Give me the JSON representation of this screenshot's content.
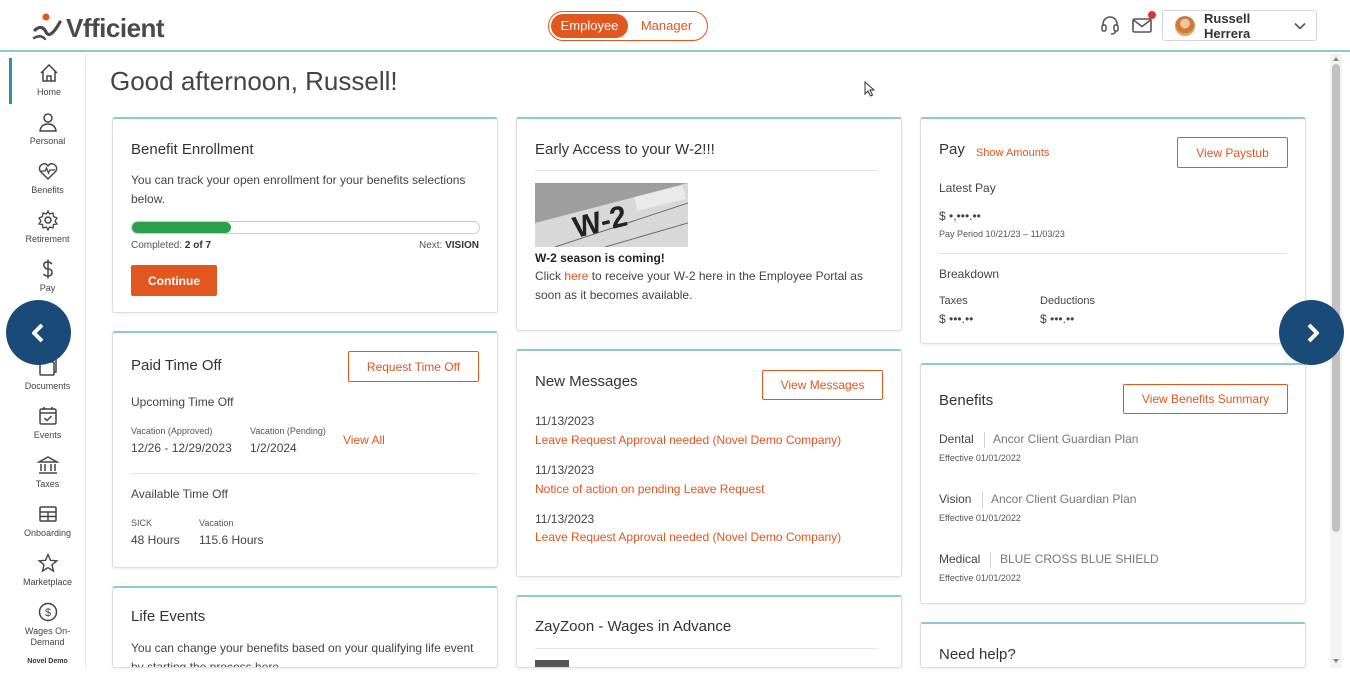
{
  "brand": {
    "name": "Vfficient",
    "accent": "#e2561f",
    "teal": "#2a93a3",
    "navy": "#1a4b78"
  },
  "header": {
    "toggle": [
      "Employee",
      "Manager"
    ],
    "active_view": "Employee",
    "icons": [
      "headset-icon",
      "mail-icon"
    ],
    "user_name": "Russell Herrera"
  },
  "sidebar": {
    "items": [
      {
        "label": "Home",
        "icon": "home-icon"
      },
      {
        "label": "Personal",
        "icon": "person-icon"
      },
      {
        "label": "Benefits",
        "icon": "heartbeat-icon"
      },
      {
        "label": "Retirement",
        "icon": "gear-icon"
      },
      {
        "label": "Pay",
        "icon": "dollar-icon"
      },
      {
        "label": "Documents",
        "icon": "documents-icon"
      },
      {
        "label": "Events",
        "icon": "calendar-icon"
      },
      {
        "label": "Taxes",
        "icon": "bank-icon"
      },
      {
        "label": "Onboarding",
        "icon": "table-icon"
      },
      {
        "label": "Marketplace",
        "icon": "star-icon"
      },
      {
        "label": "Wages On-Demand",
        "icon": "coin-icon"
      }
    ],
    "active": "Home",
    "company": "Novel Demo"
  },
  "greeting": "Good afternoon, Russell!",
  "benefit_enrollment": {
    "title": "Benefit Enrollment",
    "body": "You can track your open enrollment for your benefits selections below.",
    "completed_label": "Completed:",
    "completed_value": "2 of 7",
    "progress": 0.2857,
    "next_label": "Next:",
    "next_value": "VISION",
    "button": "Continue"
  },
  "pto": {
    "title": "Paid Time Off",
    "button": "Request Time Off",
    "upcoming_label": "Upcoming Time Off",
    "approved_label": "Vacation (Approved)",
    "approved_value": "12/26 - 12/29/2023",
    "pending_label": "Vacation (Pending)",
    "pending_value": "1/2/2024",
    "view_all": "View All",
    "available_label": "Available Time Off",
    "sick_label": "SICK",
    "sick_value": "48 Hours",
    "vacation_label": "Vacation",
    "vacation_value": "115.6 Hours"
  },
  "life_events": {
    "title": "Life Events",
    "body": "You can change your benefits based on your qualifying life event by starting the process here."
  },
  "w2": {
    "title": "Early Access to your W-2!!!",
    "image_text": "W-2",
    "headline": "W-2 season is coming!",
    "body_prefix": "Click ",
    "link": "here",
    "body_suffix": " to receive your W-2 here in the Employee Portal as soon as it becomes available."
  },
  "messages": {
    "title": "New Messages",
    "button": "View Messages",
    "items": [
      {
        "date": "11/13/2023",
        "text": "Leave Request Approval needed (Novel Demo Company)"
      },
      {
        "date": "11/13/2023",
        "text": "Notice of action on pending Leave Request"
      },
      {
        "date": "11/13/2023",
        "text": "Leave Request Approval needed (Novel Demo Company)"
      }
    ]
  },
  "zayzoon": {
    "title": "ZayZoon - Wages in Advance"
  },
  "pay": {
    "title": "Pay",
    "show_amounts": "Show Amounts",
    "button": "View Paystub",
    "latest_label": "Latest Pay",
    "latest_value": "$ •,•••.••",
    "period": "Pay Period 10/21/23 – 11/03/23",
    "breakdown_label": "Breakdown",
    "taxes_label": "Taxes",
    "taxes_value": "$ •••.••",
    "deductions_label": "Deductions",
    "deductions_value": "$ •••.••"
  },
  "benefits": {
    "title": "Benefits",
    "button": "View Benefits Summary",
    "items": [
      {
        "type": "Dental",
        "plan": "Ancor Client Guardian Plan",
        "effective": "Effective 01/01/2022"
      },
      {
        "type": "Vision",
        "plan": "Ancor Client Guardian Plan",
        "effective": "Effective 01/01/2022"
      },
      {
        "type": "Medical",
        "plan": "BLUE CROSS BLUE SHIELD",
        "effective": "Effective 01/01/2022"
      }
    ]
  },
  "help": {
    "title": "Need help?"
  }
}
